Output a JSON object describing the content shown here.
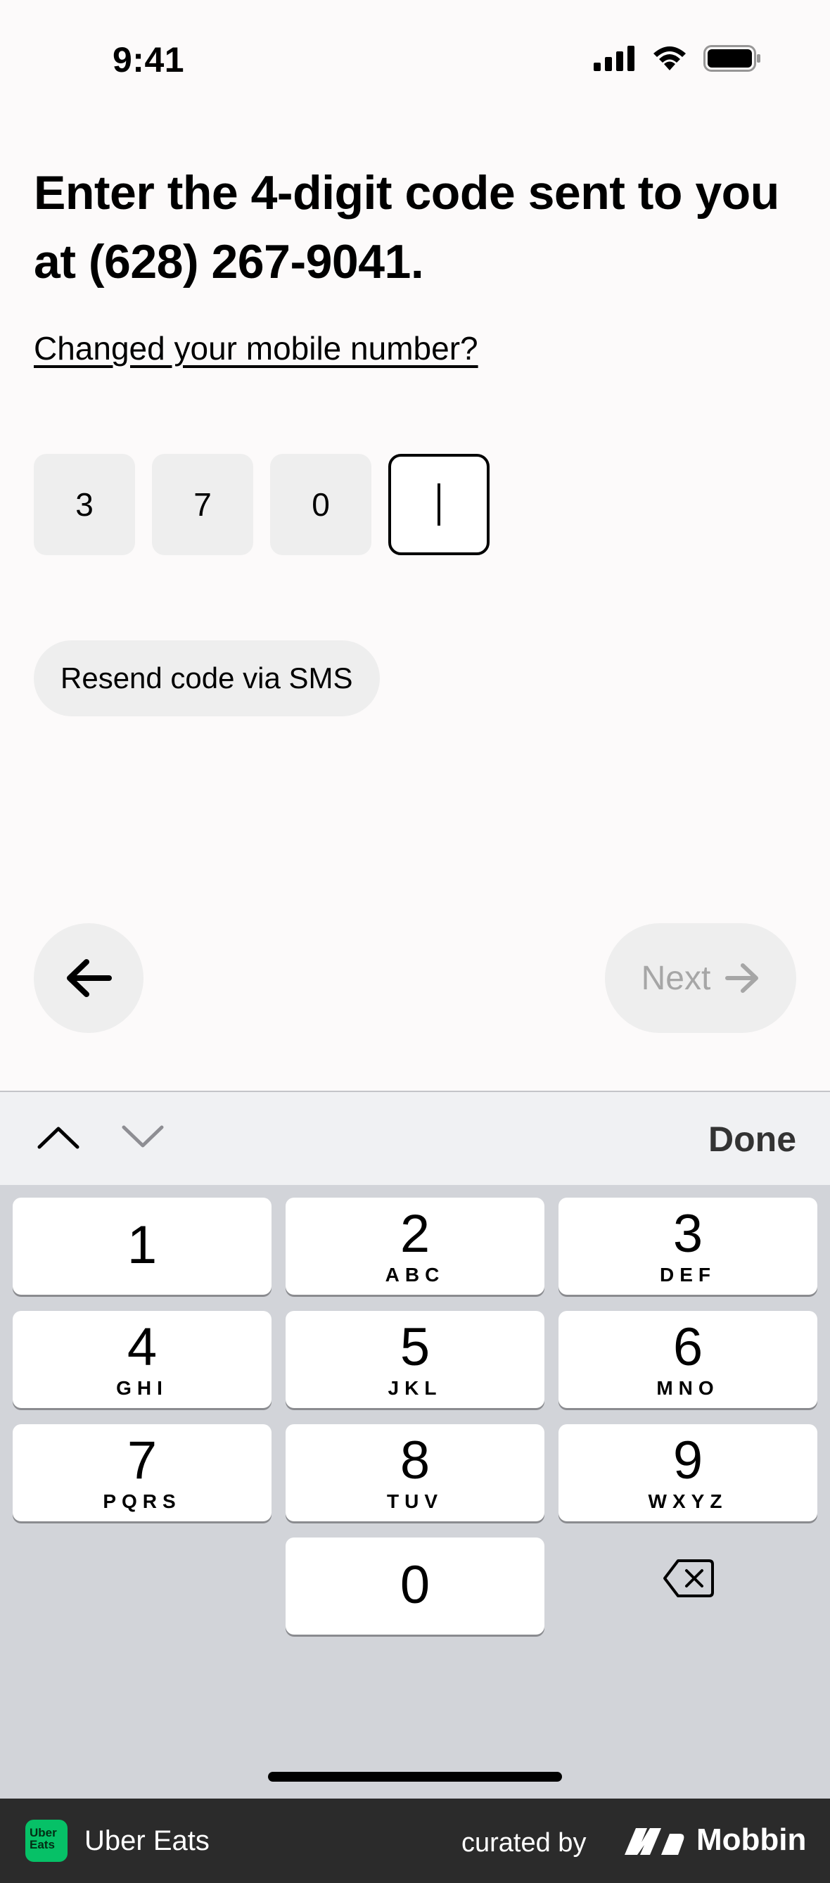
{
  "status_bar": {
    "time": "9:41"
  },
  "headline": "Enter the 4-digit code sent to you at (628) 267-9041.",
  "change_link": "Changed your mobile number?",
  "code_digits": [
    "3",
    "7",
    "0",
    ""
  ],
  "resend_label": "Resend code via SMS",
  "next_label": "Next",
  "keyboard": {
    "done_label": "Done",
    "keys": [
      {
        "num": "1",
        "letters": ""
      },
      {
        "num": "2",
        "letters": "ABC"
      },
      {
        "num": "3",
        "letters": "DEF"
      },
      {
        "num": "4",
        "letters": "GHI"
      },
      {
        "num": "5",
        "letters": "JKL"
      },
      {
        "num": "6",
        "letters": "MNO"
      },
      {
        "num": "7",
        "letters": "PQRS"
      },
      {
        "num": "8",
        "letters": "TUV"
      },
      {
        "num": "9",
        "letters": "WXYZ"
      },
      {
        "num": "0",
        "letters": ""
      }
    ]
  },
  "footer": {
    "app_logo_text": "Uber Eats",
    "app_name": "Uber Eats",
    "curated_by": "curated by",
    "brand": "Mobbin"
  },
  "colors": {
    "uber_green": "#06c167",
    "button_gray": "#eeeeee",
    "disabled_text": "#a6a6a6"
  }
}
